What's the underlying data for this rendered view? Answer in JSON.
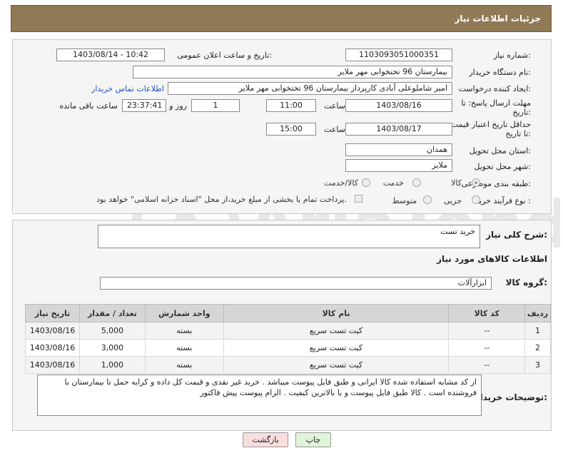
{
  "header": {
    "title": "جزئیات اطلاعات نیاز"
  },
  "form": {
    "need_number_label": "شماره نیاز:",
    "need_number": "1103093051000351",
    "announce_label": "تاریخ و ساعت اعلان عمومی:",
    "announce_value": "1403/08/14 - 10:42",
    "buyer_org_label": "نام دستگاه خریدار:",
    "buyer_org": "بیمارستان 96 تختخوابی مهر ملایر",
    "creator_label": "ایجاد کننده درخواست:",
    "creator": "امیر شاملوعلی آبادی کارپرداز بیمارستان 96 تختخوابی مهر ملایر",
    "contact_link": "اطلاعات تماس خریدار",
    "deadline_label": "مهلت ارسال پاسخ: تا تاریخ:",
    "deadline_date": "1403/08/16",
    "time_label": "ساعت",
    "deadline_time": "11:00",
    "days_value": "1",
    "days_label": "روز و",
    "remaining_time": "23:37:41",
    "remaining_label": "ساعت باقی مانده",
    "validity_label": "حداقل تاریخ اعتبار قیمت: تا تاریخ:",
    "validity_date": "1403/08/17",
    "validity_time": "15:00",
    "province_label": "استان محل تحویل:",
    "province": "همدان",
    "city_label": "شهر محل تحویل:",
    "city": "ملایر",
    "category_label": "طبقه بندی موضوعی:",
    "category_options": [
      "کالا",
      "خدمت",
      "کالا/خدمت"
    ],
    "purchase_type_label": "نوع فرآیند خرید :",
    "purchase_type_options": [
      "جزیی",
      "متوسط"
    ],
    "payment_note": "پرداخت تمام یا بخشی از مبلغ خرید،از محل \"اسناد خزانه اسلامی\" خواهد بود."
  },
  "details": {
    "description_label": "شرح کلی نیاز:",
    "description": "خرید تست",
    "goods_info_title": "اطلاعات کالاهای مورد نیاز",
    "goods_group_label": "گروه کالا:",
    "goods_group": "ابزارآلات",
    "table": {
      "headers": [
        "ردیف",
        "کد کالا",
        "نام کالا",
        "واحد شمارش",
        "تعداد / مقدار",
        "تاریخ نیاز"
      ],
      "rows": [
        [
          "1",
          "--",
          "کیت تست سریع",
          "بسته",
          "5,000",
          "1403/08/16"
        ],
        [
          "2",
          "--",
          "کیت تست سریع",
          "بسته",
          "3,000",
          "1403/08/16"
        ],
        [
          "3",
          "--",
          "کیت تست سریع",
          "بسته",
          "1,000",
          "1403/08/16"
        ]
      ]
    },
    "buyer_notes_label": "توضیحات خریدار:",
    "buyer_notes": "از کد مشابه استفاده شده کالا ایرانی و طبق فایل پیوست میباشد . خرید غیر نقدی و قیمت کل داده و کرایه حمل تا بیمارستان با فروشنده است . کالا طبق فایل پیوست و با بالاترین کیفیت . الزام پیوست پیش فاکتور"
  },
  "buttons": {
    "print": "چاپ",
    "back": "بازگشت"
  },
  "watermark": "AriaTender.net",
  "colors": {
    "header": "#8f7a55",
    "link": "#1a55b8",
    "print_btn": "#dff5d8",
    "back_btn": "#f8dede"
  }
}
